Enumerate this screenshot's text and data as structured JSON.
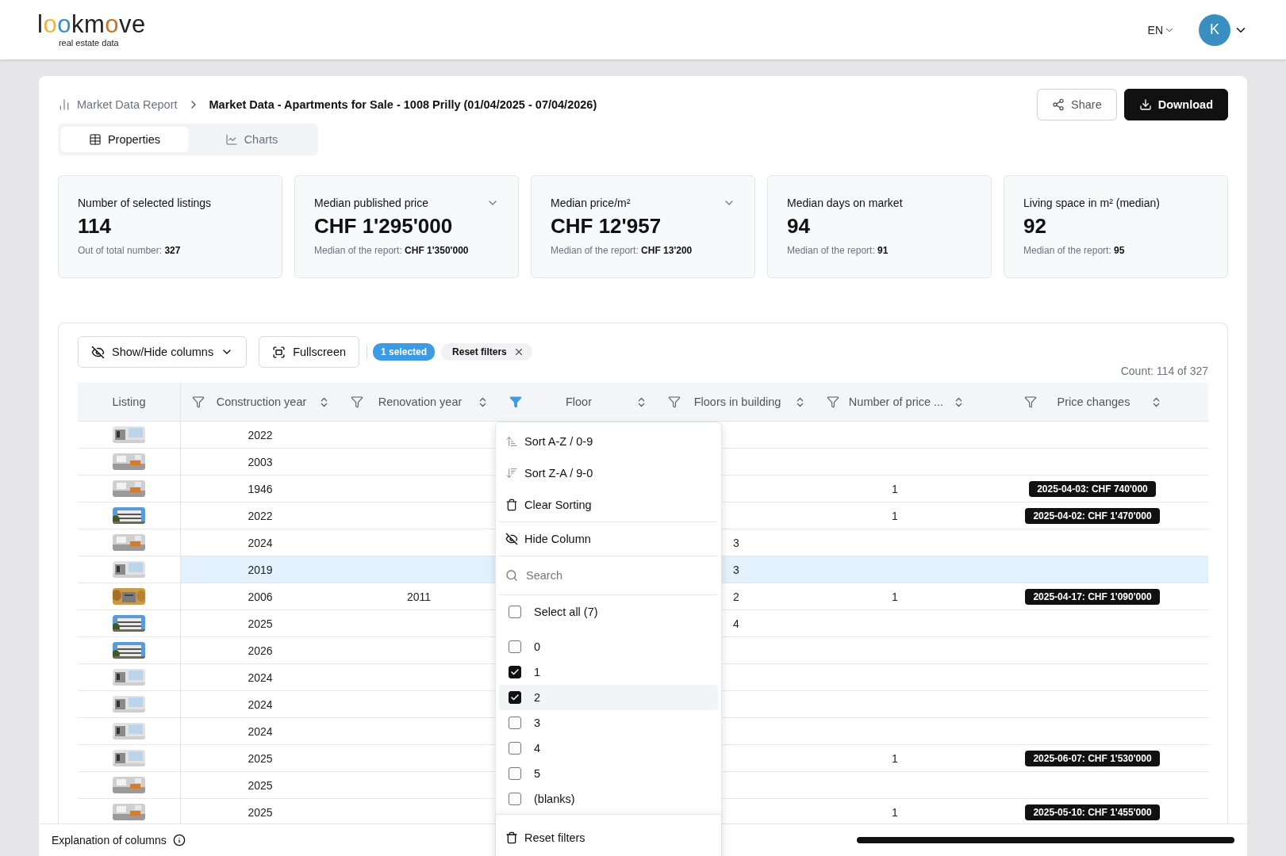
{
  "header": {
    "logo": "lookmove",
    "tagline": "real estate data",
    "language": "EN",
    "avatar_initial": "K"
  },
  "breadcrumb": [
    {
      "label": "Market Data Report",
      "current": false
    },
    {
      "label": "Market Data - Apartments for Sale - 1008 Prilly (01/04/2025 - 07/04/2026)",
      "current": true
    }
  ],
  "actions": [
    {
      "label": "Share",
      "kind": "outline"
    },
    {
      "label": "Download",
      "kind": "primary"
    }
  ],
  "view_tabs": [
    {
      "label": "Properties",
      "selected": true
    },
    {
      "label": "Charts",
      "selected": false
    }
  ],
  "stats": [
    {
      "title": "Number of selected listings",
      "value": "114",
      "note": "Out of total number: **327**",
      "dropdown": false
    },
    {
      "title": "Median published price",
      "value": "CHF 1'295'000",
      "note": "Median of the report: **CHF 1'350'000**",
      "dropdown": true
    },
    {
      "title": "Median price/m²",
      "value": "CHF 12'957",
      "note": "Median of the report: **CHF 13'200**",
      "dropdown": true
    },
    {
      "title": "Median days on market",
      "value": "94",
      "note": "Median of the report: **91**",
      "dropdown": false
    },
    {
      "title": "Living space in m² (median)",
      "value": "92",
      "note": "Median of the report: **95**",
      "dropdown": false
    }
  ],
  "toolbar": {
    "columns_button": "Show/Hide columns",
    "fullscreen_button": "Fullscreen",
    "selected_badge": "1 selected",
    "reset_chip": "Reset filters",
    "count": "Count: 114 of 327"
  },
  "table": {
    "columns": [
      {
        "label": "Listing"
      },
      {
        "label": "Construction year",
        "kind": "data",
        "filter_active": false
      },
      {
        "label": "Renovation year",
        "kind": "data",
        "filter_active": false
      },
      {
        "label": "Floor",
        "kind": "data",
        "filter_active": true
      },
      {
        "label": "Floors in building",
        "kind": "data",
        "filter_active": false
      },
      {
        "label": "Number of price ...",
        "kind": "data",
        "filter_active": false
      },
      {
        "label": "Price changes",
        "kind": "data",
        "filter_active": false
      }
    ],
    "rows": [
      {
        "selected": false,
        "construction_year": "2022"
      },
      {
        "selected": false,
        "construction_year": "2003"
      },
      {
        "selected": false,
        "construction_year": "1946",
        "price_change_count": "1",
        "price_changes": "2025-04-03: CHF 740'000"
      },
      {
        "selected": false,
        "construction_year": "2022",
        "price_change_count": "1",
        "price_changes": "2025-04-02: CHF 1'470'000"
      },
      {
        "selected": false,
        "construction_year": "2024",
        "floors_in_building": "3"
      },
      {
        "selected": true,
        "construction_year": "2019",
        "floors_in_building": "3"
      },
      {
        "selected": false,
        "construction_year": "2006",
        "renovation_year": "2011",
        "floors_in_building": "2",
        "price_change_count": "1",
        "price_changes": "2025-04-17: CHF 1'090'000"
      },
      {
        "selected": false,
        "construction_year": "2025",
        "floors_in_building": "4"
      },
      {
        "selected": false,
        "construction_year": "2026"
      },
      {
        "selected": false,
        "construction_year": "2024"
      },
      {
        "selected": false,
        "construction_year": "2024"
      },
      {
        "selected": false,
        "construction_year": "2024"
      },
      {
        "selected": false,
        "construction_year": "2025",
        "price_change_count": "1",
        "price_changes": "2025-06-07: CHF 1'530'000"
      },
      {
        "selected": false,
        "construction_year": "2025"
      },
      {
        "selected": false,
        "construction_year": "2025",
        "price_change_count": "1",
        "price_changes": "2025-05-10: CHF 1'455'000"
      }
    ]
  },
  "filter_menu": {
    "actions": [
      "Sort A-Z / 0-9",
      "Sort Z-A / 9-0",
      "Clear Sorting"
    ],
    "hide_column": "Hide Column",
    "search_placeholder": "Search",
    "select_all": {
      "label": "Select all (7)",
      "checked": false
    },
    "options": [
      {
        "label": "0",
        "checked": false,
        "hovered": false
      },
      {
        "label": "1",
        "checked": true,
        "hovered": false
      },
      {
        "label": "2",
        "checked": true,
        "hovered": true
      },
      {
        "label": "3",
        "checked": false,
        "hovered": false
      },
      {
        "label": "4",
        "checked": false,
        "hovered": false
      },
      {
        "label": "5",
        "checked": false,
        "hovered": false
      },
      {
        "label": "(blanks)",
        "checked": false,
        "hovered": false
      }
    ],
    "reset": "Reset filters"
  },
  "footer": {
    "explanation": "Explanation of columns"
  }
}
